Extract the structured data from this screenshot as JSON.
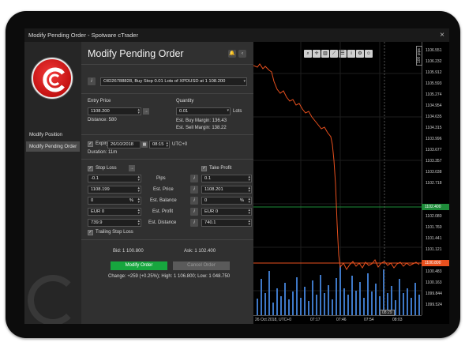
{
  "window": {
    "title": "Modify Pending Order - Spotware cTrader",
    "close_icon": "×"
  },
  "sidebar": {
    "items": [
      {
        "label": "Modify Position",
        "active": false
      },
      {
        "label": "Modify Pending Order",
        "active": true
      }
    ]
  },
  "panel": {
    "title": "Modify Pending Order",
    "order_select": "OID26788828, Buy Stop 0.01 Lots of XPDUSD at 1 108.200",
    "entry_price": {
      "label": "Entry Price",
      "value": "1108.200",
      "distance": "Distance: 580"
    },
    "quantity": {
      "label": "Quantity",
      "value": "0.01",
      "unit": "Lots",
      "buy_margin": "Est. Buy Margin: 136.43",
      "sell_margin": "Est. Sell Margin: 138.22"
    },
    "expiry": {
      "label": "Expiry",
      "date": "26/10/2018",
      "time": "08:15",
      "tz": "UTC+0",
      "duration": "Duration: 11m"
    },
    "stop_loss": {
      "label": "Stop Loss",
      "pips": "-0.1",
      "price": "1108.199",
      "balance": "0",
      "balance_unit": "%",
      "profit_currency": "EUR",
      "profit_value": "0",
      "distance": "739.9"
    },
    "take_profit": {
      "label": "Take Profit",
      "pips": "0.1",
      "price": "1108.201",
      "balance": "0",
      "balance_unit": "%",
      "profit_currency": "EUR",
      "profit_value": "0",
      "distance": "740.1"
    },
    "row_labels": [
      "Pips",
      "Est. Price",
      "Est. Balance",
      "Est. Profit",
      "Est. Distance"
    ],
    "trailing_stop": "Trailing Stop Loss",
    "bid": "Bid: 1 100.800",
    "ask": "Ask: 1 102.400",
    "modify_button": "Modify Order",
    "cancel_button": "Cancel Order",
    "change_text": "Change: +259 (+0.25%); High: 1 106.800; Low: 1 048.750"
  },
  "chart": {
    "pips_label": "100 pips",
    "y_ticks": [
      "1106.551",
      "1106.232",
      "1105.912",
      "1105.593",
      "1105.274",
      "1104.954",
      "1104.635",
      "1104.315",
      "1103.996",
      "1103.677",
      "1103.357",
      "1103.038",
      "1102.718",
      "1102.400",
      "1102.080",
      "1101.760",
      "1101.441",
      "1101.121",
      "1100.800",
      "1100.483",
      "1100.163",
      "1099.844",
      "1099.524"
    ],
    "bid_tag": "1100.800",
    "ask_tag": "1102.400",
    "x_ticks": [
      "26 Oct 2018, UTC+0",
      "07:17",
      "07:46",
      "07:54",
      "08:03"
    ],
    "cursor_time": "08:29",
    "colors": {
      "price_line": "#e8501e",
      "ask_line": "#1e8c3a",
      "bid_line": "#e8501e",
      "volume": "#3e78c7"
    }
  }
}
